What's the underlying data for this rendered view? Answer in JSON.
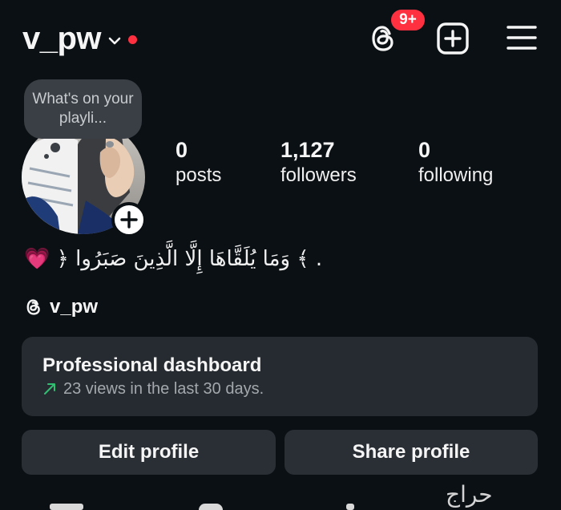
{
  "header": {
    "username": "v_pw",
    "notification_count": "9+"
  },
  "note": {
    "text": "What's on your playli..."
  },
  "stats": {
    "posts": {
      "count": "0",
      "label": "posts"
    },
    "followers": {
      "count": "1,127",
      "label": "followers"
    },
    "following": {
      "count": "0",
      "label": "following"
    }
  },
  "bio": {
    "text": "﴿ وَمَا يُلَقَّاهَا إِلَّا الَّذِينَ صَبَرُوا ﴾ .",
    "emoji": "💗"
  },
  "threads": {
    "handle": "v_pw"
  },
  "dashboard": {
    "title": "Professional dashboard",
    "subtitle": "23 views in the last 30 days."
  },
  "actions": {
    "edit_label": "Edit profile",
    "share_label": "Share profile"
  },
  "watermark": {
    "text": "حراج"
  },
  "colors": {
    "background": "#0b1014",
    "badge": "#ff3040",
    "card": "#262b31",
    "button": "#2a2f36",
    "trend_arrow": "#2fbf71",
    "heart": "#ff4fa3"
  },
  "icons": {
    "threads": "threads-icon",
    "add": "add-post-icon",
    "menu": "hamburger-menu-icon",
    "chevron": "chevron-down-icon",
    "trend": "trending-up-arrow-icon"
  }
}
